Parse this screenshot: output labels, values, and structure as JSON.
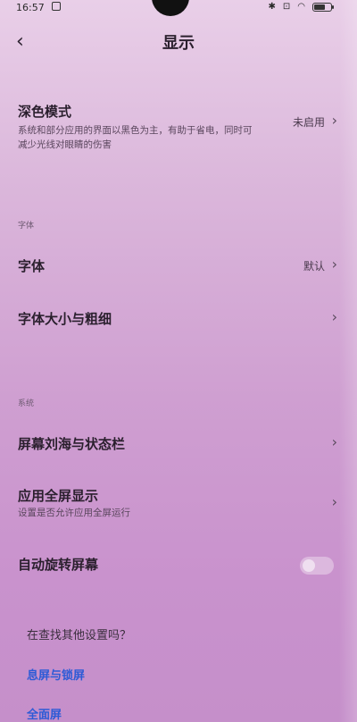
{
  "status_bar": {
    "time": "16:57"
  },
  "header": {
    "title": "显示"
  },
  "dark_mode": {
    "label": "深色模式",
    "desc": "系统和部分应用的界面以黑色为主，有助于省电，同时可减少光线对眼睛的伤害",
    "value": "未启用"
  },
  "section_font": "字体",
  "font_row": {
    "label": "字体",
    "value": "默认"
  },
  "font_size_row": {
    "label": "字体大小与粗细"
  },
  "section_system": "系统",
  "notch_row": {
    "label": "屏幕刘海与状态栏"
  },
  "fullscreen_row": {
    "label": "应用全屏显示",
    "desc": "设置是否允许应用全屏运行"
  },
  "autorotate_row": {
    "label": "自动旋转屏幕"
  },
  "other_settings": {
    "hint": "在查找其他设置吗？",
    "links": [
      "息屏与锁屏",
      "全面屏"
    ]
  },
  "colors": {
    "accent_link": "#2d5bd6"
  }
}
